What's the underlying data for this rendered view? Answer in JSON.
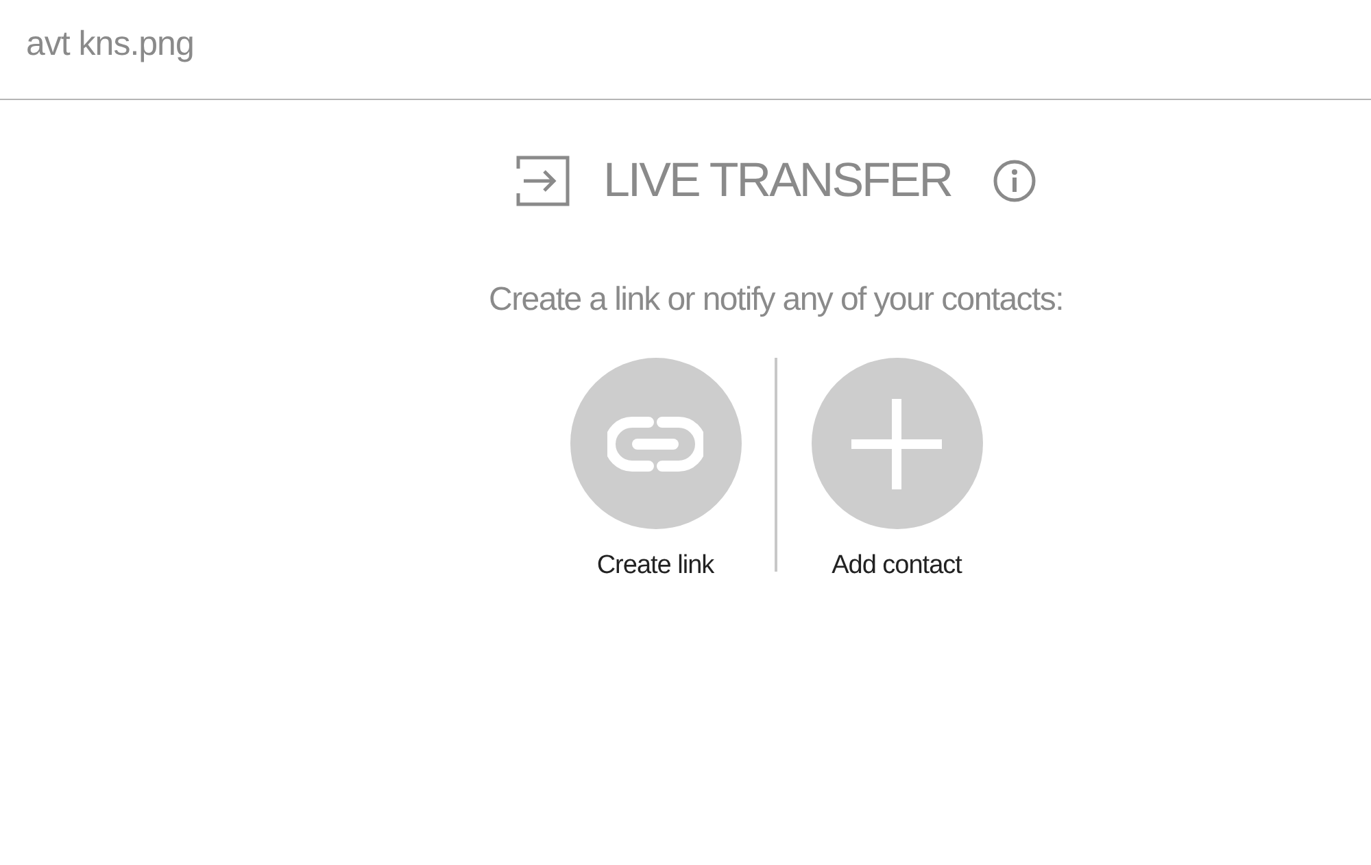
{
  "header": {
    "filename": "avt kns.png"
  },
  "panel": {
    "title": "LIVE TRANSFER",
    "subtitle": "Create a link or notify any of your contacts:"
  },
  "actions": [
    {
      "label": "Create link",
      "kind": "link"
    },
    {
      "label": "Add contact",
      "kind": "add"
    }
  ]
}
